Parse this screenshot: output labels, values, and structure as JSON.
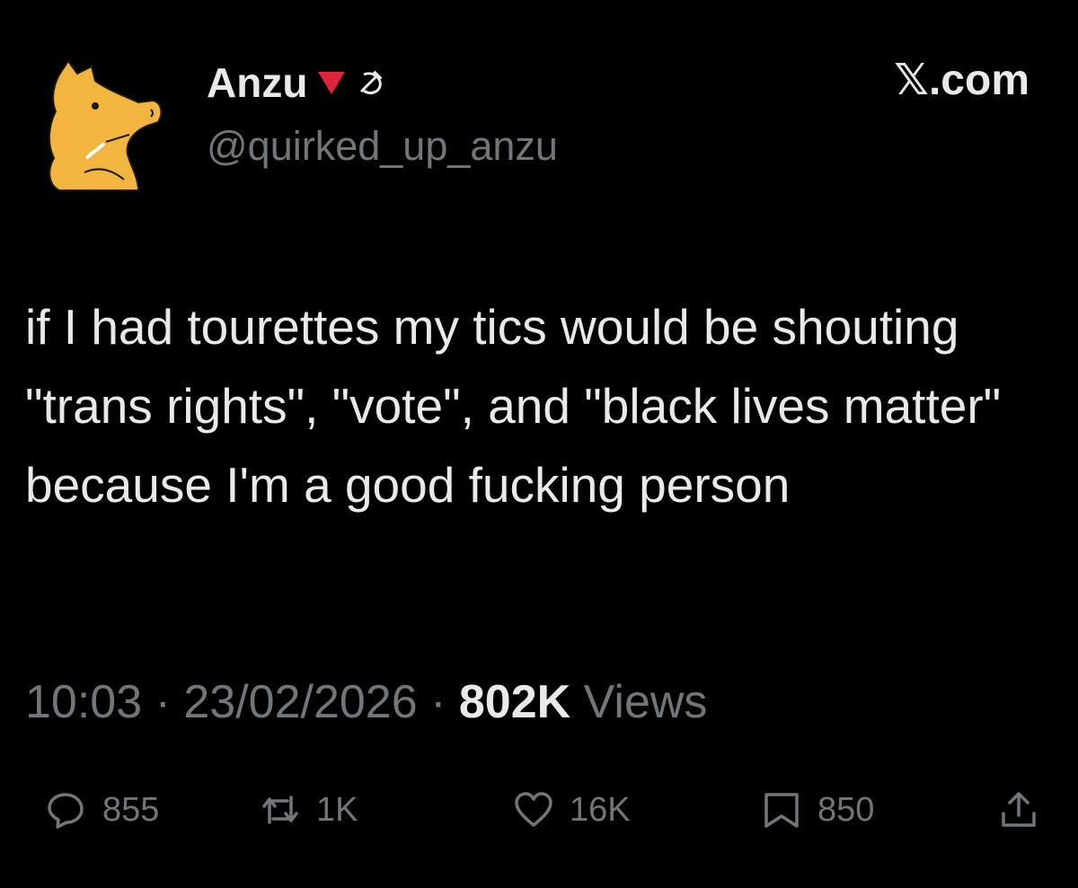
{
  "author": {
    "display_name": "Anzu",
    "handle": "@quirked_up_anzu",
    "name_emojis": [
      "red-triangle-down",
      "hammer-and-sickle"
    ],
    "avatar_color": "#f2b53f"
  },
  "brand": {
    "label": "𝕏.com"
  },
  "tweet": {
    "text": "if I had tourettes my tics would be shouting \"trans rights\", \"vote\", and \"black lives matter\" because I'm a good fucking person"
  },
  "meta": {
    "time": "10:03",
    "separator": "·",
    "date": "23/02/2026",
    "views_count": "802K",
    "views_label": "Views"
  },
  "actions": {
    "reply_count": "855",
    "repost_count": "1K",
    "like_count": "16K",
    "bookmark_count": "850"
  },
  "colors": {
    "background": "#000000",
    "text_primary": "#e7e9ea",
    "text_secondary": "#71767b",
    "emoji_red": "#e0243b"
  }
}
